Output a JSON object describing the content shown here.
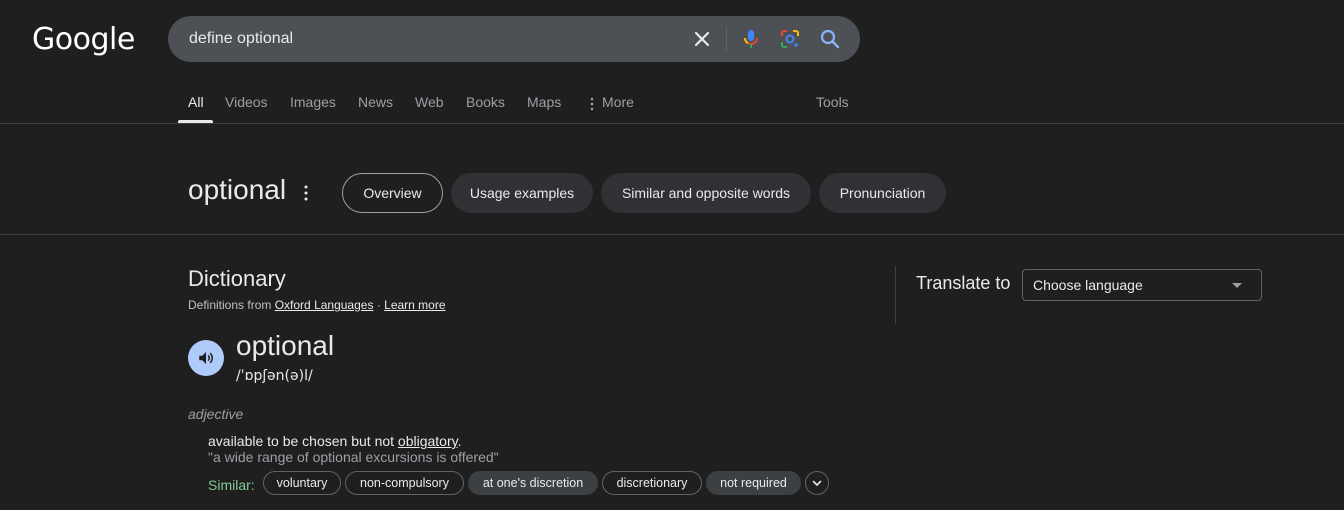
{
  "header": {
    "logo": "Google",
    "search": {
      "value": "define optional"
    }
  },
  "tabs": [
    {
      "label": "All"
    },
    {
      "label": "Videos"
    },
    {
      "label": "Images"
    },
    {
      "label": "News"
    },
    {
      "label": "Web"
    },
    {
      "label": "Books"
    },
    {
      "label": "Maps"
    },
    {
      "label": "More"
    }
  ],
  "tools_label": "Tools",
  "word_header": {
    "title": "optional",
    "chips": [
      "Overview",
      "Usage examples",
      "Similar and opposite words",
      "Pronunciation"
    ],
    "active_chip": "Overview"
  },
  "dictionary": {
    "title": "Dictionary",
    "defs_from_prefix": "Definitions from",
    "source": "Oxford Languages",
    "separator": "·",
    "learn_more": "Learn more",
    "headword": "optional",
    "phonetic": "/ˈɒpʃən(ə)l/",
    "part_of_speech": "adjective",
    "definition_prefix": "available to be chosen but not ",
    "definition_link": "obligatory",
    "definition_suffix": ".",
    "example": "\"a wide range of optional excursions is offered\"",
    "similar_label": "Similar:",
    "similar": [
      "voluntary",
      "non-compulsory",
      "at one's discretion",
      "discretionary",
      "not required"
    ]
  },
  "translate": {
    "label": "Translate to",
    "select_value": "Choose language"
  },
  "colors": {
    "background": "#1f1f1f",
    "accent_blue": "#8ab4f8",
    "similar_green": "#81c995"
  }
}
